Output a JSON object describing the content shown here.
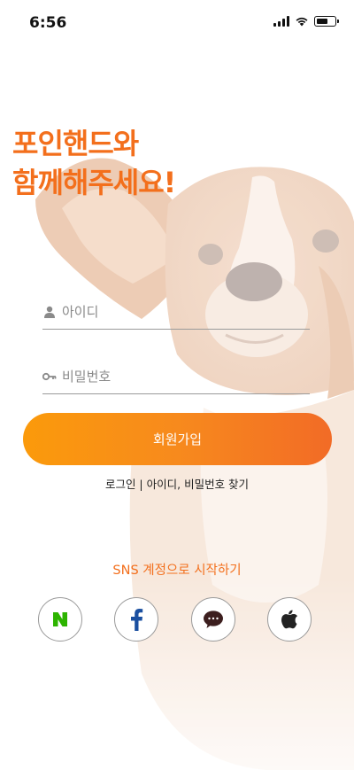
{
  "status_bar": {
    "time": "6:56"
  },
  "headline": {
    "line1": "포인핸드와",
    "line2": "함께해주세요!"
  },
  "form": {
    "id_placeholder": "아이디",
    "pw_placeholder": "비밀번호"
  },
  "signup_button": {
    "label": "회원가입"
  },
  "links": {
    "login": "로그인",
    "separator": " | ",
    "find": "아이디, 비밀번호 찾기"
  },
  "sns": {
    "title": "SNS 계정으로 시작하기",
    "providers": [
      "naver",
      "facebook",
      "kakao",
      "apple"
    ]
  },
  "colors": {
    "accent": "#f36f1c",
    "button_gradient_start": "#fb9a0b",
    "button_gradient_end": "#f26b26",
    "naver": "#2db400",
    "facebook": "#1a4fa0",
    "kakao": "#3c1e1e"
  }
}
